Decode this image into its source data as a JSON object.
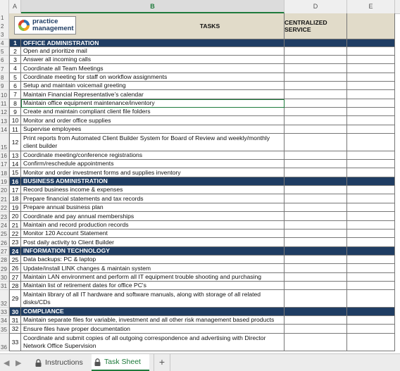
{
  "columns": {
    "a": "A",
    "b": "B",
    "d": "D",
    "e": "E"
  },
  "header": {
    "tasks_label": "TASKS",
    "centralized_label": "CENTRALIZED SERVICE",
    "logo": {
      "line1": "practice",
      "line2": "management"
    },
    "row_numbers": [
      "1",
      "2",
      "3"
    ]
  },
  "rows": [
    {
      "rn": "4",
      "num": "1",
      "text": "OFFICE ADMINISTRATION",
      "section": true,
      "h": 11
    },
    {
      "rn": "5",
      "num": "2",
      "text": "Open and prioritize mail",
      "h": 12
    },
    {
      "rn": "6",
      "num": "3",
      "text": "Answer all incoming calls",
      "h": 12
    },
    {
      "rn": "7",
      "num": "4",
      "text": "Coordinate all Team Meetings",
      "h": 13
    },
    {
      "rn": "8",
      "num": "5",
      "text": "Coordinate meeting for staff on workflow assignments",
      "h": 12
    },
    {
      "rn": "9",
      "num": "6",
      "text": "Setup and maintain voicemail greeting",
      "h": 12
    },
    {
      "rn": "10",
      "num": "7",
      "text": "Maintain Financial Representative’s calendar",
      "h": 13
    },
    {
      "rn": "11",
      "num": "8",
      "text": "Maintain office equipment maintenance/inventory",
      "h": 12,
      "selected": true
    },
    {
      "rn": "12",
      "num": "9",
      "text": "Create and maintain compliant client file folders",
      "h": 12
    },
    {
      "rn": "13",
      "num": "10",
      "text": "Monitor and order office supplies",
      "h": 13
    },
    {
      "rn": "14",
      "num": "11",
      "text": "Supervise employees",
      "h": 12
    },
    {
      "rn": "15",
      "num": "12",
      "text": "Print reports from Automated Client Builder System for Board of Review and weekly/monthly client builder",
      "h": 25
    },
    {
      "rn": "16",
      "num": "13",
      "text": "Coordinate meeting/conference registrations",
      "h": 12
    },
    {
      "rn": "17",
      "num": "14",
      "text": "Confirm/reschedule appointments",
      "h": 12
    },
    {
      "rn": "18",
      "num": "15",
      "text": "Monitor and order investment forms and supplies inventory",
      "h": 13
    },
    {
      "rn": "19",
      "num": "16",
      "text": "BUSINESS ADMINISTRATION",
      "section": true,
      "h": 12
    },
    {
      "rn": "20",
      "num": "17",
      "text": "Record business income & expenses",
      "h": 12
    },
    {
      "rn": "21",
      "num": "18",
      "text": "Prepare financial statements and tax records",
      "h": 13
    },
    {
      "rn": "22",
      "num": "19",
      "text": "Prepare annual business plan",
      "h": 12
    },
    {
      "rn": "23",
      "num": "20",
      "text": "Coordinate and pay annual memberships",
      "h": 13
    },
    {
      "rn": "24",
      "num": "21",
      "text": "Maintain and record production records",
      "h": 12
    },
    {
      "rn": "25",
      "num": "22",
      "text": "Monitor 120 Account Statement",
      "h": 12
    },
    {
      "rn": "26",
      "num": "23",
      "text": "Post daily activity to Client Builder",
      "h": 13
    },
    {
      "rn": "27",
      "num": "24",
      "text": "INFORMATION TECHNOLOGY",
      "section": true,
      "h": 12
    },
    {
      "rn": "28",
      "num": "25",
      "text": "Data backups:  PC & laptop",
      "h": 12
    },
    {
      "rn": "29",
      "num": "26",
      "text": "Update/install LINK changes & maintain system",
      "h": 13
    },
    {
      "rn": "30",
      "num": "27",
      "text": "Maintain LAN environment and perform all IT equipment trouble shooting and purchasing",
      "h": 12
    },
    {
      "rn": "31",
      "num": "28",
      "text": "Maintain list of retirement dates for office PC's",
      "h": 12
    },
    {
      "rn": "32",
      "num": "29",
      "text": "Maintain library of all IT hardware and software manuals, along with storage of all related disks/CDs",
      "h": 25
    },
    {
      "rn": "33",
      "num": "30",
      "text": "COMPLIANCE",
      "section": true,
      "h": 12
    },
    {
      "rn": "34",
      "num": "31",
      "text": "Maintain separate files for variable, investment and all other risk management based products",
      "h": 12
    },
    {
      "rn": "35",
      "num": "32",
      "text": "Ensure files have proper documentation",
      "h": 13
    },
    {
      "rn": "36",
      "num": "33",
      "text": "Coordinate and submit copies of all outgoing correspondence and advertising with Director Network Office Supervision",
      "h": 25
    }
  ],
  "tabs": [
    {
      "label": "Instructions",
      "locked": true,
      "active": false
    },
    {
      "label": "Task Sheet",
      "locked": true,
      "active": true
    }
  ],
  "add_tab_label": "+",
  "nav": {
    "prev": "◀",
    "next": "▶"
  },
  "colors": {
    "section": "#1f3d63",
    "header": "#e1dbc9",
    "accent": "#1e7a3b"
  }
}
